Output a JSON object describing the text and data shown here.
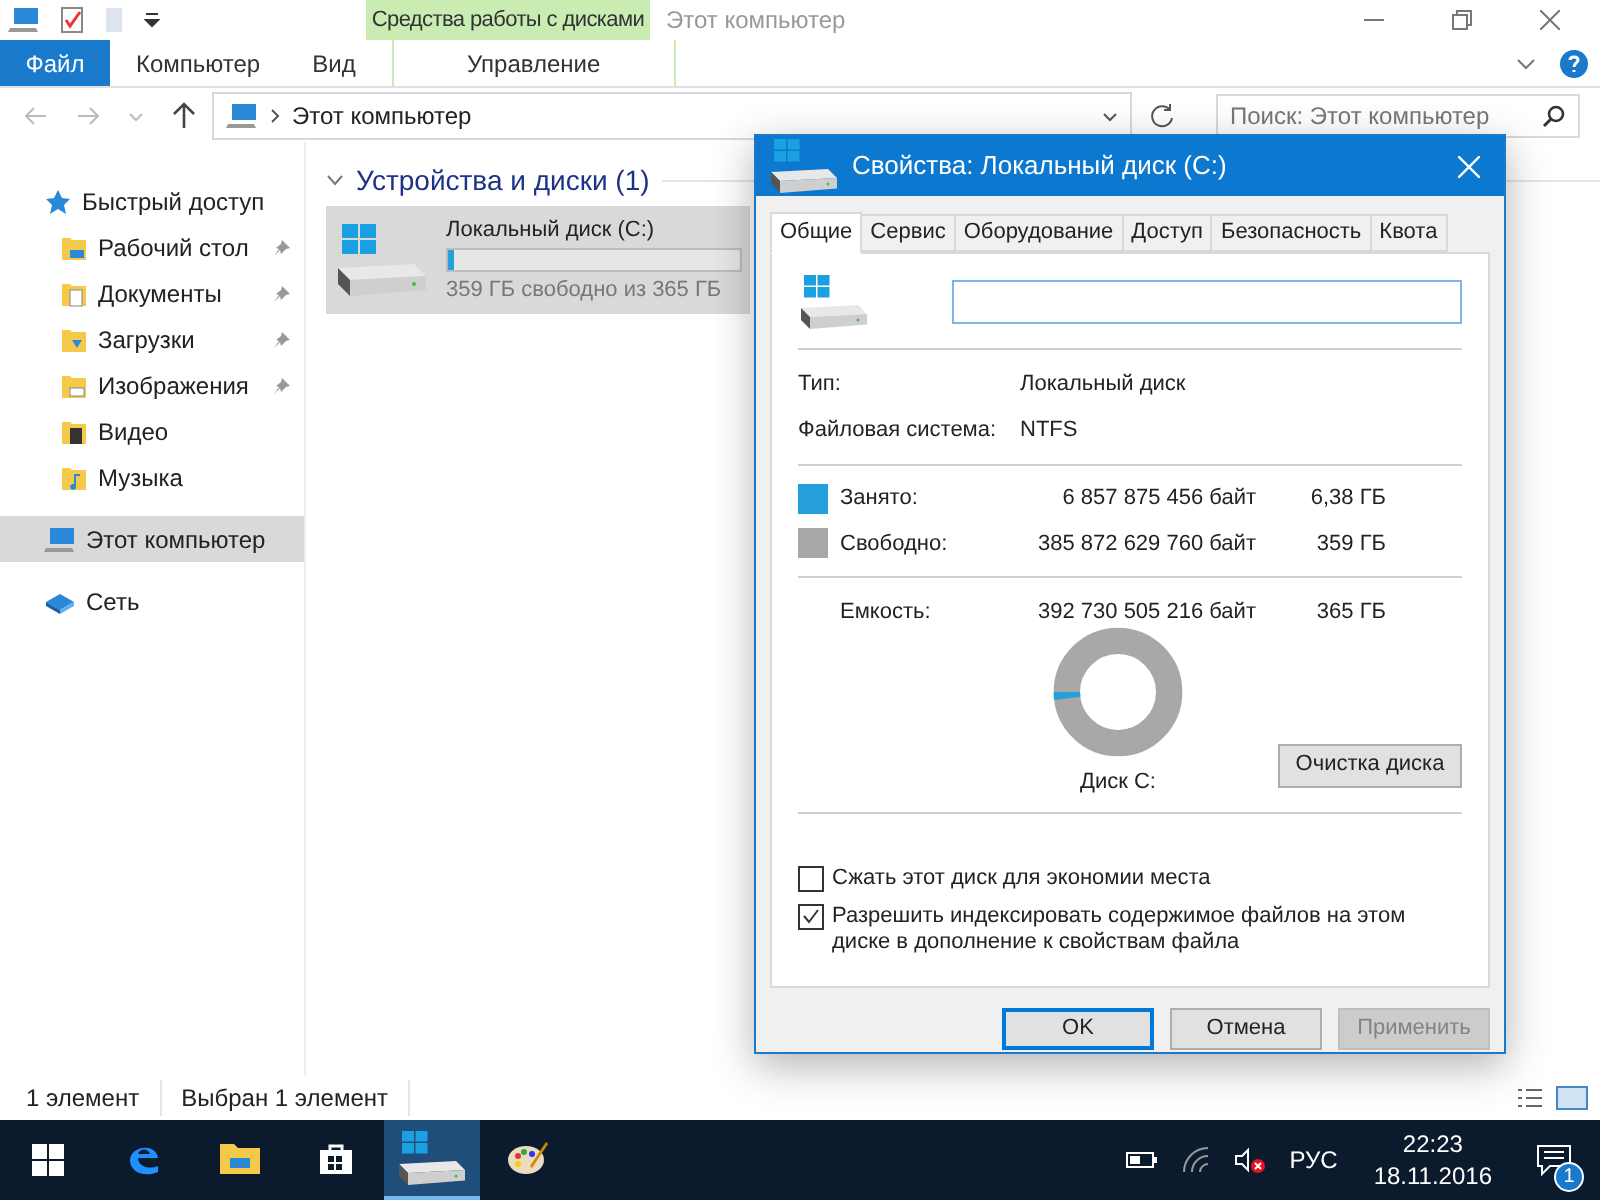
{
  "window": {
    "title": "Этот компьютер",
    "context_tab": "Средства работы с дисками"
  },
  "ribbon_tabs": [
    {
      "label": "Файл",
      "kind": "file",
      "selected": false
    },
    {
      "label": "Компьютер",
      "kind": "tab",
      "selected": false
    },
    {
      "label": "Вид",
      "kind": "tab",
      "selected": false
    },
    {
      "label": "Управление",
      "kind": "context",
      "selected": false
    }
  ],
  "address": {
    "path": "Этот компьютер",
    "search_placeholder": "Поиск: Этот компьютер"
  },
  "sidebar": {
    "items": [
      {
        "label": "Быстрый доступ",
        "kind": "star",
        "selected": false,
        "children": [
          {
            "label": "Рабочий стол",
            "kind": "desktop",
            "pinned": true,
            "selected": false
          },
          {
            "label": "Документы",
            "kind": "documents",
            "pinned": true,
            "selected": false
          },
          {
            "label": "Загрузки",
            "kind": "downloads",
            "pinned": true,
            "selected": false
          },
          {
            "label": "Изображения",
            "kind": "pictures",
            "pinned": true,
            "selected": false
          },
          {
            "label": "Видео",
            "kind": "video",
            "pinned": false,
            "selected": false
          },
          {
            "label": "Музыка",
            "kind": "music",
            "pinned": false,
            "selected": false
          }
        ]
      },
      {
        "label": "Этот компьютер",
        "kind": "computer",
        "selected": true
      },
      {
        "label": "Сеть",
        "kind": "network",
        "selected": false
      }
    ]
  },
  "content": {
    "group": "Устройства и диски (1)",
    "drives": [
      {
        "name": "Локальный диск (C:)",
        "free": "359 ГБ свободно из 365 ГБ",
        "level": 0.02,
        "selected": true
      }
    ]
  },
  "status_bar": {
    "count": "1 элемент",
    "selection": "Выбран 1 элемент"
  },
  "dialog": {
    "title": "Свойства: Локальный диск (C:)",
    "tabs": [
      {
        "label": "Общие",
        "selected": true
      },
      {
        "label": "Сервис",
        "selected": false
      },
      {
        "label": "Оборудование",
        "selected": false
      },
      {
        "label": "Доступ",
        "selected": false
      },
      {
        "label": "Безопасность",
        "selected": false
      },
      {
        "label": "Квота",
        "selected": false
      }
    ],
    "info": [
      {
        "label": "Тип:",
        "value": "Локальный диск"
      },
      {
        "label": "Файловая система:",
        "value": "NTFS"
      }
    ],
    "usage": [
      {
        "label": "Занято:",
        "bytes": "6 857 875 456 байт",
        "size": "6,38 ГБ",
        "color": "#26a0da"
      },
      {
        "label": "Свободно:",
        "bytes": "385 872 629 760 байт",
        "size": "359 ГБ",
        "color": "#a8a8a8"
      }
    ],
    "capacity": {
      "label": "Емкость:",
      "bytes": "392 730 505 216 байт",
      "size": "365 ГБ"
    },
    "donut": {
      "level": 0.02,
      "caption": "Диск C:"
    },
    "cleanup_button": "Очистка диска",
    "options": [
      {
        "label": "Сжать этот диск для экономии места",
        "checked": false
      },
      {
        "label": "Разрешить индексировать содержимое файлов на этом диске в дополнение к свойствам файла",
        "checked": true
      }
    ],
    "buttons": [
      {
        "label": "OK",
        "default": true,
        "disabled": false
      },
      {
        "label": "Отмена",
        "default": false,
        "disabled": false
      },
      {
        "label": "Применить",
        "default": false,
        "disabled": true
      }
    ]
  },
  "taskbar": {
    "apps": [
      {
        "kind": "start",
        "selected": false
      },
      {
        "kind": "edge",
        "selected": false
      },
      {
        "kind": "explorer",
        "selected": false
      },
      {
        "kind": "store",
        "selected": false
      },
      {
        "kind": "drive",
        "selected": true
      },
      {
        "kind": "paint",
        "selected": false
      }
    ],
    "language": "РУС",
    "time": "22:23",
    "date": "18.11.2016",
    "notifications": "1"
  }
}
